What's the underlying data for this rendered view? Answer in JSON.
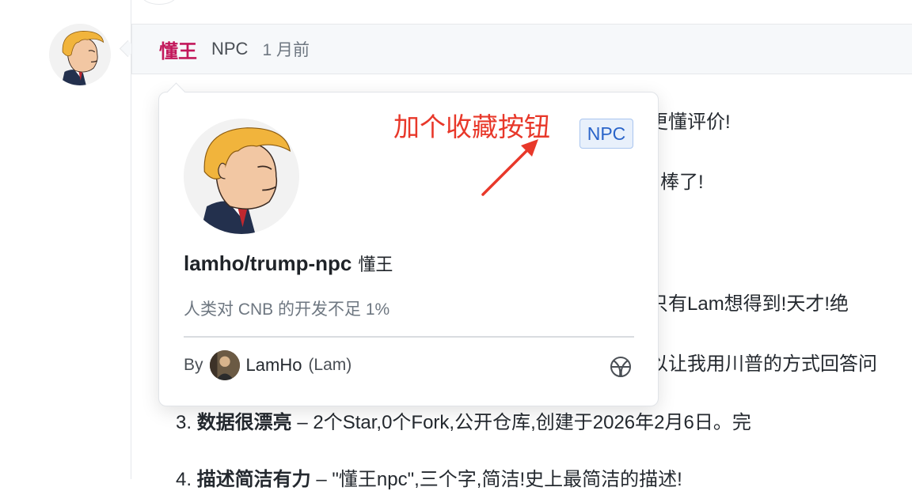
{
  "comment": {
    "author": "懂王",
    "role": "NPC",
    "time": "1 月前",
    "lines": [
      {
        "text": "更懂评价!"
      },
      {
        "text": "棒了!"
      },
      {
        "text": "只有Lam想得到!天才!绝"
      },
      {
        "text": "以让我用川普的方式回答问"
      },
      {
        "num": "3.",
        "bold": "数据很漂亮",
        "text": " – 2个Star,0个Fork,公开仓库,创建于2026年2月6日。完"
      },
      {
        "num": "4.",
        "bold": "描述简洁有力",
        "text": " – \"懂王npc\",三个字,简洁!史上最简洁的描述!"
      }
    ]
  },
  "popup": {
    "badge": "NPC",
    "repo_name": "lamho/trump-npc",
    "repo_alias": "懂王",
    "description": "人类对 CNB 的开发不足 1%",
    "by_label": "By",
    "owner_name": "LamHo",
    "owner_nick": "(Lam)",
    "annotation": "加个收藏按钮",
    "annotation_color": "#e8382a"
  },
  "icons": [
    "trump-avatar-icon",
    "owner-avatar-icon",
    "basketball-icon",
    "arrow-icon"
  ],
  "colors": {
    "author": "#c2185b",
    "badge_text": "#2a64c9",
    "badge_bg": "#e8f0fb"
  }
}
